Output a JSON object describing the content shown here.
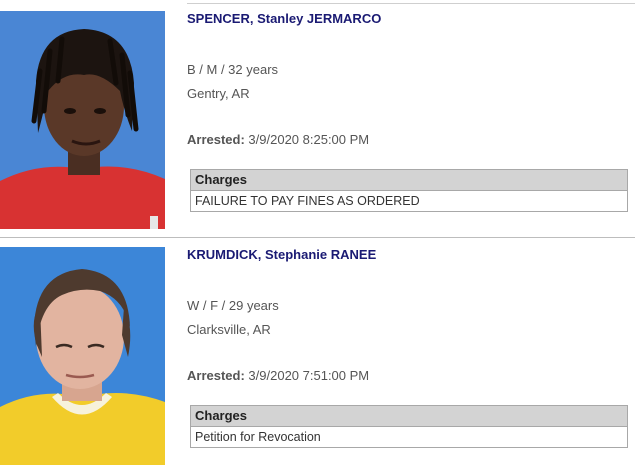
{
  "records": [
    {
      "name": "SPENCER, Stanley JERMARCO",
      "demographics": "B / M / 32 years",
      "location": "Gentry, AR",
      "arrested_label": "Arrested:",
      "arrested_value": "3/9/2020 8:25:00 PM",
      "charges_header": "Charges",
      "charges": [
        "FAILURE TO PAY FINES AS ORDERED"
      ]
    },
    {
      "name": "KRUMDICK, Stephanie RANEE",
      "demographics": "W / F / 29 years",
      "location": "Clarksville, AR",
      "arrested_label": "Arrested:",
      "arrested_value": "3/9/2020 7:51:00 PM",
      "charges_header": "Charges",
      "charges": [
        "Petition for Revocation"
      ]
    }
  ],
  "colors": {
    "name_link": "#1a1a73",
    "text": "#555555",
    "charges_header_bg": "#d3d3d3",
    "border": "#a8a8a8"
  }
}
